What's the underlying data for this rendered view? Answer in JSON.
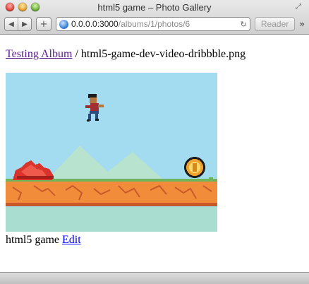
{
  "window": {
    "title": "html5 game – Photo Gallery"
  },
  "toolbar": {
    "back_icon": "back-arrow-icon",
    "forward_icon": "forward-arrow-icon",
    "add_icon": "plus-icon",
    "url_host": "0.0.0.0:3000",
    "url_path": "/albums/1/photos/6",
    "reload_icon": "reload-icon",
    "reader_label": "Reader",
    "overflow_icon": "double-chevron-icon"
  },
  "breadcrumb": {
    "album_link": "Testing Album",
    "separator": " / ",
    "filename": "html5-game-dev-video-dribbble.png"
  },
  "photo": {
    "alt": "html5 game"
  },
  "caption": {
    "title": "html5 game",
    "edit_link": "Edit"
  }
}
